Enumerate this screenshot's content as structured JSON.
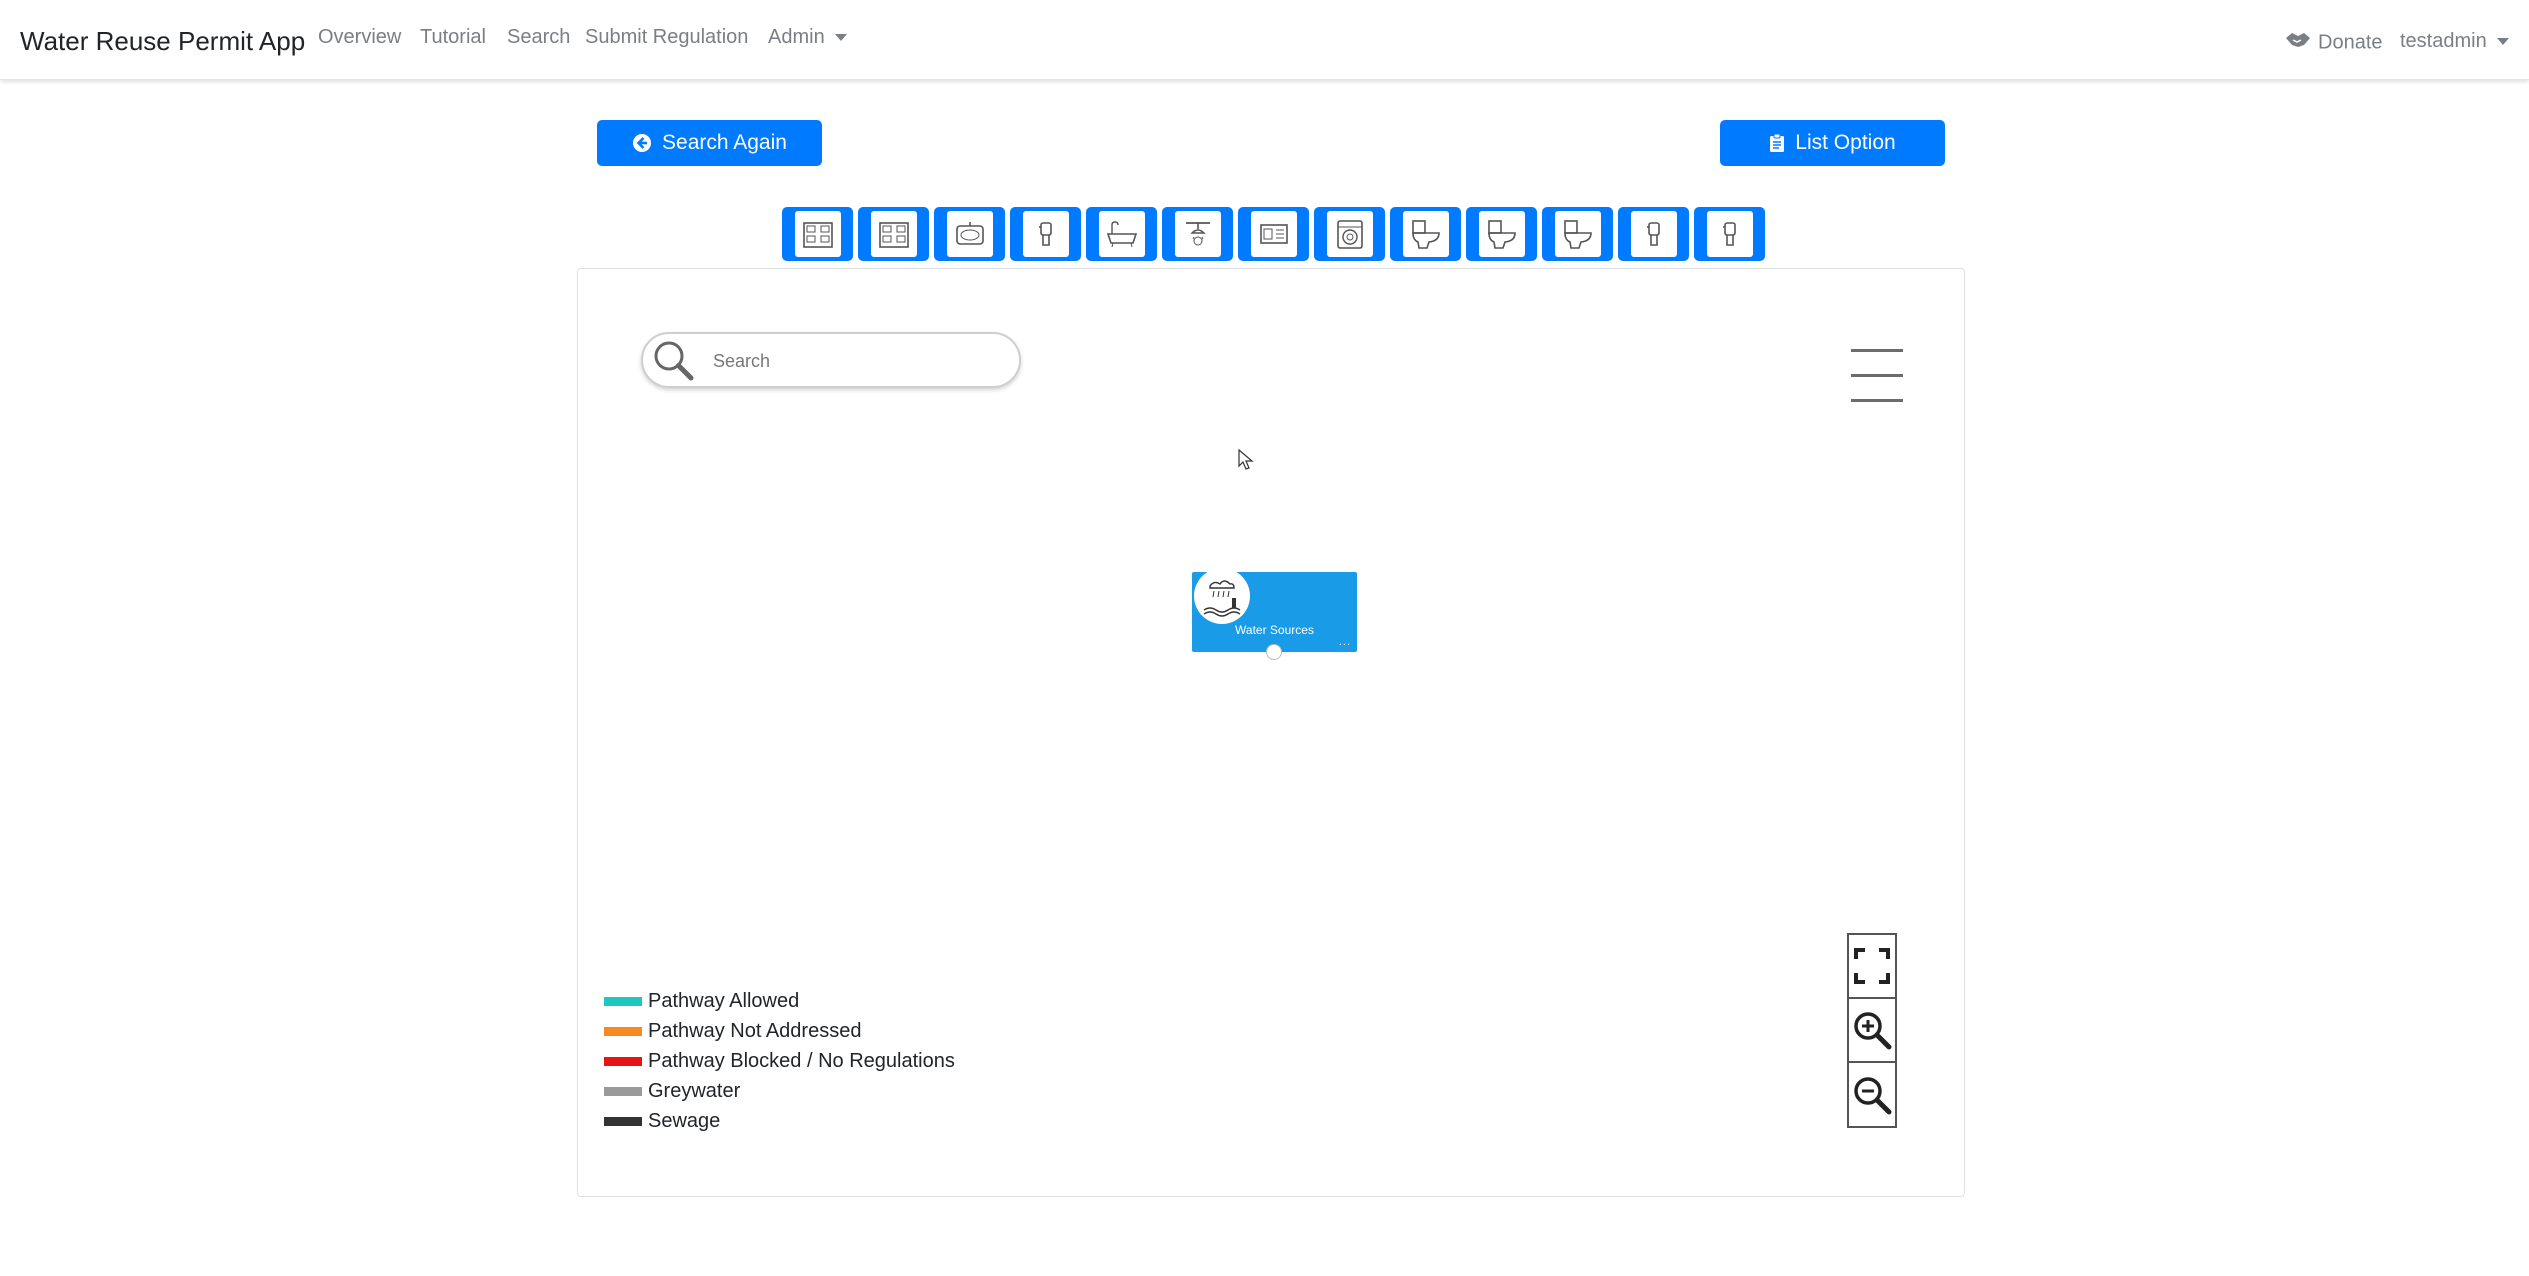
{
  "app": {
    "brand": "Water Reuse Permit App"
  },
  "nav": {
    "overview": "Overview",
    "tutorial": "Tutorial",
    "search": "Search",
    "submit_regulation": "Submit Regulation",
    "admin": "Admin",
    "donate": "Donate",
    "user": "testadmin"
  },
  "actions": {
    "search_again": "Search Again",
    "list_option": "List Option"
  },
  "fixtures": [
    {
      "icon": "building-icon"
    },
    {
      "icon": "building-icon"
    },
    {
      "icon": "sink-icon"
    },
    {
      "icon": "faucet-icon"
    },
    {
      "icon": "bathtub-icon"
    },
    {
      "icon": "shower-icon"
    },
    {
      "icon": "dishwasher-icon"
    },
    {
      "icon": "washing-machine-icon"
    },
    {
      "icon": "toilet-icon"
    },
    {
      "icon": "toilet-icon"
    },
    {
      "icon": "toilet-icon"
    },
    {
      "icon": "faucet-icon"
    },
    {
      "icon": "faucet-icon"
    }
  ],
  "diagram": {
    "search_placeholder": "Search",
    "node": {
      "label": "Water Sources",
      "more": "..."
    }
  },
  "legend": [
    {
      "label": "Pathway Allowed",
      "color": "#1ec8c0"
    },
    {
      "label": "Pathway Not Addressed",
      "color": "#f7891f"
    },
    {
      "label": "Pathway Blocked / No Regulations",
      "color": "#e81313"
    },
    {
      "label": "Greywater",
      "color": "#9a9a9a"
    },
    {
      "label": "Sewage",
      "color": "#333333"
    }
  ],
  "colors": {
    "primary": "#007bff",
    "node": "#1a9be8"
  }
}
